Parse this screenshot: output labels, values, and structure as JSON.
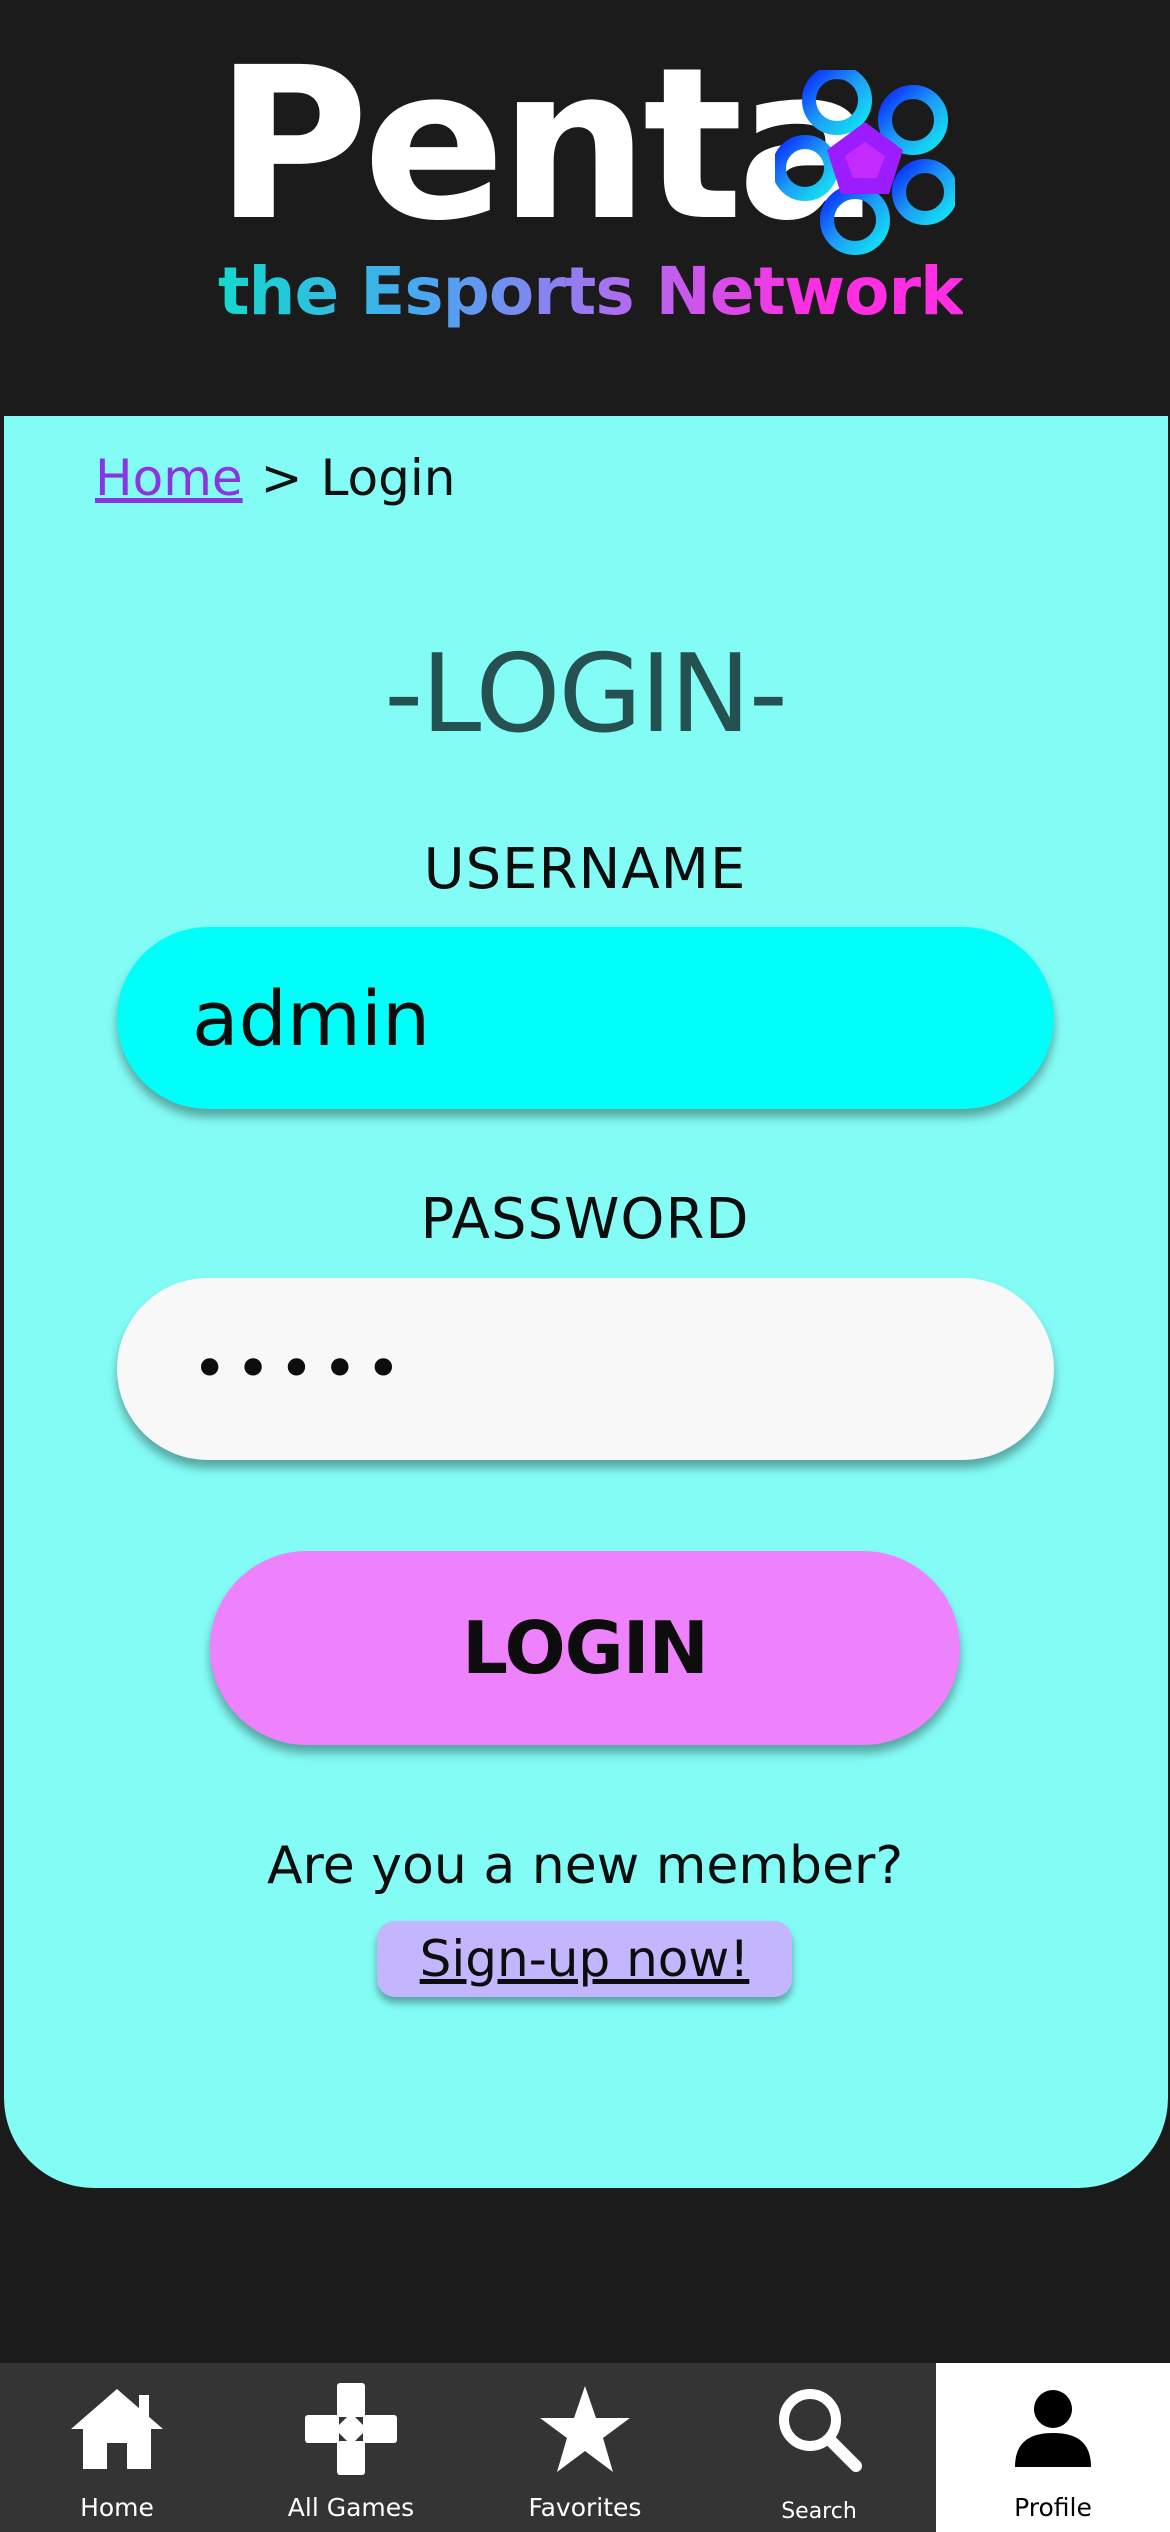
{
  "brand": {
    "name": "Penta",
    "tagline": "the Esports Network"
  },
  "breadcrumb": {
    "home": "Home",
    "separator": ">",
    "current": "Login"
  },
  "form": {
    "title": "-LOGIN-",
    "username_label": "USERNAME",
    "username_value": "admin",
    "password_label": "PASSWORD",
    "password_value": "•••••",
    "submit_label": "LOGIN",
    "new_member_text": "Are you a new member?",
    "signup_label": "Sign-up now!"
  },
  "nav": {
    "items": [
      {
        "label": "Home",
        "icon": "home-icon"
      },
      {
        "label": "All Games",
        "icon": "gamepad-icon"
      },
      {
        "label": "Favorites",
        "icon": "star-icon"
      },
      {
        "label": "Search",
        "icon": "search-icon"
      },
      {
        "label": "Profile",
        "icon": "profile-icon",
        "active": true
      }
    ]
  },
  "colors": {
    "background": "#1b1b1b",
    "card": "#84fcf6",
    "username_field": "#00fff8",
    "password_field": "#f8f8f8",
    "login_button": "#ee82fc",
    "signup_button": "#c3b6ff",
    "link": "#8a35e0",
    "title": "#255250",
    "nav_bar": "#343434"
  }
}
